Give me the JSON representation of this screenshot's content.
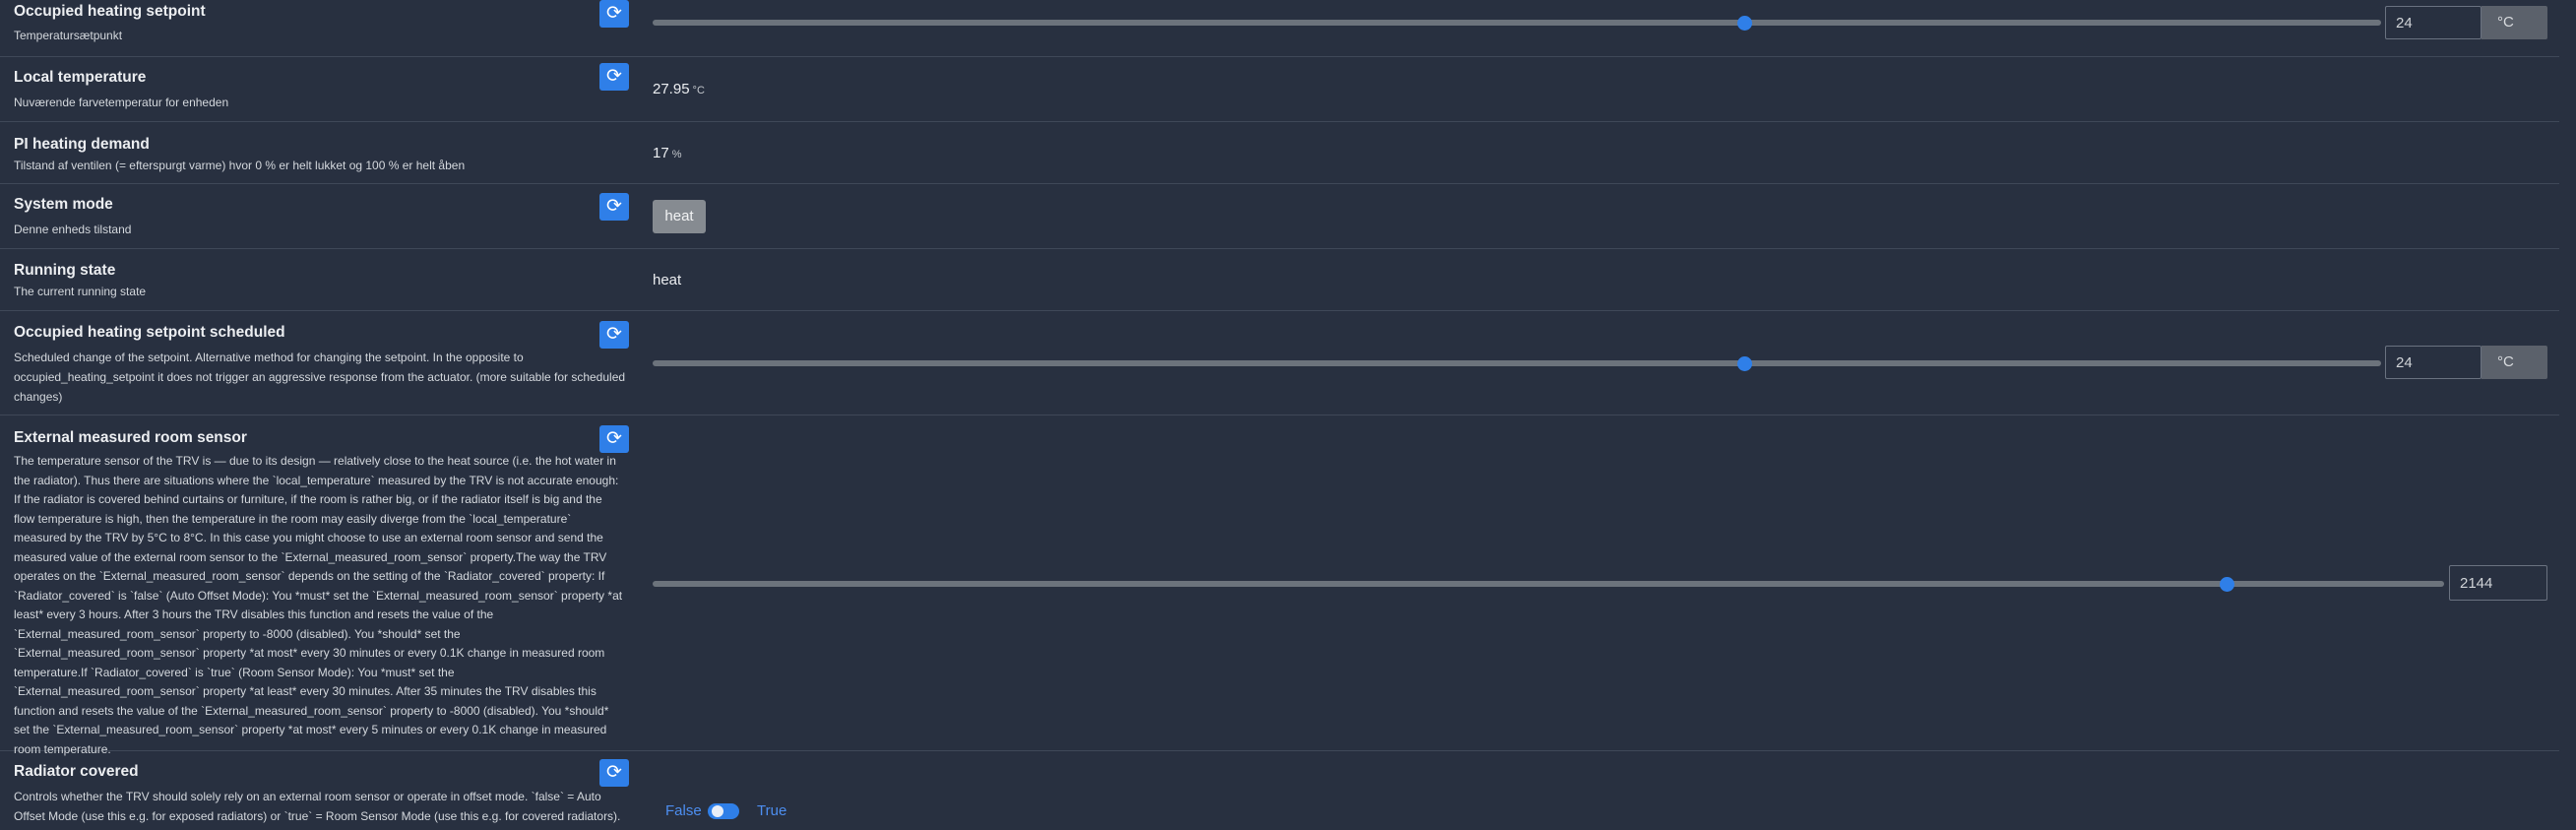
{
  "rows": [
    {
      "title": "Occupied heating setpoint",
      "desc": "Temperatursætpunkt",
      "slider_fraction": 0.632,
      "value": "24",
      "unit": "°C"
    },
    {
      "title": "Local temperature",
      "desc": "Nuværende farvetemperatur for enheden",
      "value": "27.95",
      "unit": "°C"
    },
    {
      "title": "PI heating demand",
      "desc": "Tilstand af ventilen (= efterspurgt varme) hvor 0 % er helt lukket og 100 % er helt åben",
      "value": "17",
      "unit": "%"
    },
    {
      "title": "System mode",
      "desc": "Denne enheds tilstand",
      "value": "heat"
    },
    {
      "title": "Running state",
      "desc": "The current running state",
      "value": "heat"
    },
    {
      "title": "Occupied heating setpoint scheduled",
      "desc": "Scheduled change of the setpoint. Alternative method for changing the setpoint. In the opposite to occupied_heating_setpoint it does not trigger an aggressive response from the actuator. (more suitable for scheduled changes)",
      "slider_fraction": 0.632,
      "value": "24",
      "unit": "°C"
    },
    {
      "title": "External measured room sensor",
      "desc": "The temperature sensor of the TRV is — due to its design — relatively close to the heat source (i.e. the hot water in the radiator). Thus there are situations where the `local_temperature` measured by the TRV is not accurate enough: If the radiator is covered behind curtains or furniture, if the room is rather big, or if the radiator itself is big and the flow temperature is high, then the temperature in the room may easily diverge from the `local_temperature` measured by the TRV by 5°C to 8°C. In this case you might choose to use an external room sensor and send the measured value of the external room sensor to the `External_measured_room_sensor` property.The way the TRV operates on the `External_measured_room_sensor` depends on the setting of the `Radiator_covered` property: If `Radiator_covered` is `false` (Auto Offset Mode): You *must* set the `External_measured_room_sensor` property *at least* every 3 hours. After 3 hours the TRV disables this function and resets the value of the `External_measured_room_sensor` property to -8000 (disabled). You *should* set the `External_measured_room_sensor` property *at most* every 30 minutes or every 0.1K change in measured room temperature.If `Radiator_covered` is `true` (Room Sensor Mode): You *must* set the `External_measured_room_sensor` property *at least* every 30 minutes. After 35 minutes the TRV disables this function and resets the value of the `External_measured_room_sensor` property to -8000 (disabled). You *should* set the `External_measured_room_sensor` property *at most* every 5 minutes or every 0.1K change in measured room temperature.",
      "slider_fraction": 0.88,
      "value": "2144"
    },
    {
      "title": "Radiator covered",
      "desc": "Controls whether the TRV should solely rely on an external room sensor or operate in offset mode. `false` = Auto Offset Mode (use this e.g. for exposed radiators) or `true` = Room Sensor Mode (use this e.g. for covered radiators).",
      "toggle_false_label": "False",
      "toggle_true_label": "True",
      "toggle_state": false
    }
  ],
  "icons": {
    "refresh": "refresh-icon"
  },
  "colors": {
    "background": "#283040",
    "accent": "#2f7fe8"
  }
}
